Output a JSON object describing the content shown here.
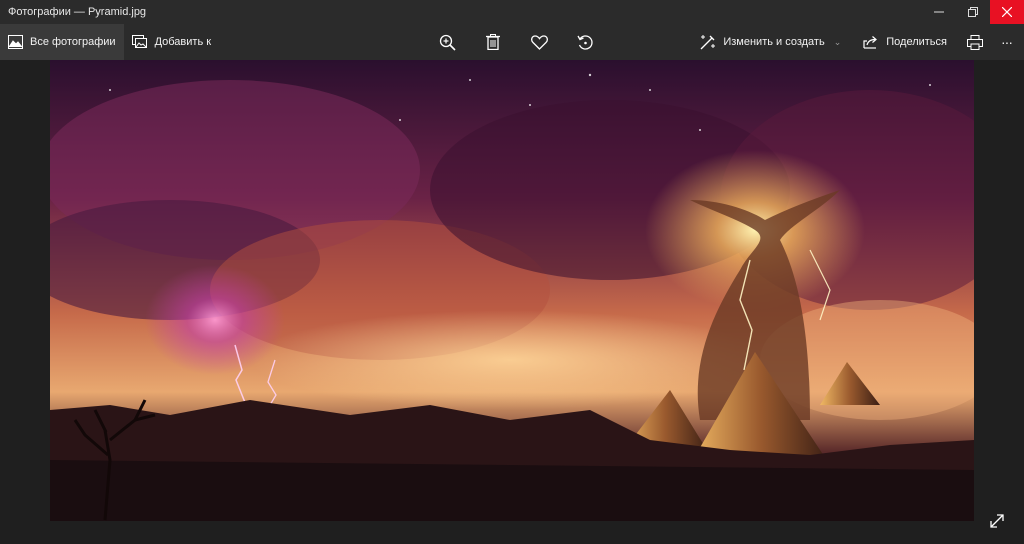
{
  "window": {
    "title": "Фотографии — Pyramid.jpg"
  },
  "toolbar": {
    "all_photos_label": "Все фотографии",
    "add_to_label": "Добавить к",
    "edit_create_label": "Изменить и создать",
    "share_label": "Поделиться",
    "more_label": "···"
  },
  "photo": {
    "subject": "pyramids under a stormy cosmic sky",
    "colors": {
      "sky_top": "#2a0f2e",
      "glow": "#f2b35c",
      "magenta": "#c23fa8",
      "ground": "#1a0d10"
    }
  },
  "icons": {
    "photos": "photo-icon",
    "add": "add-to-album-icon",
    "zoom": "zoom-in-icon",
    "delete": "trash-icon",
    "favorite": "heart-icon",
    "rotate": "rotate-icon",
    "edit": "edit-create-icon",
    "share": "share-icon",
    "print": "print-icon",
    "fullscreen": "fullscreen-icon"
  }
}
